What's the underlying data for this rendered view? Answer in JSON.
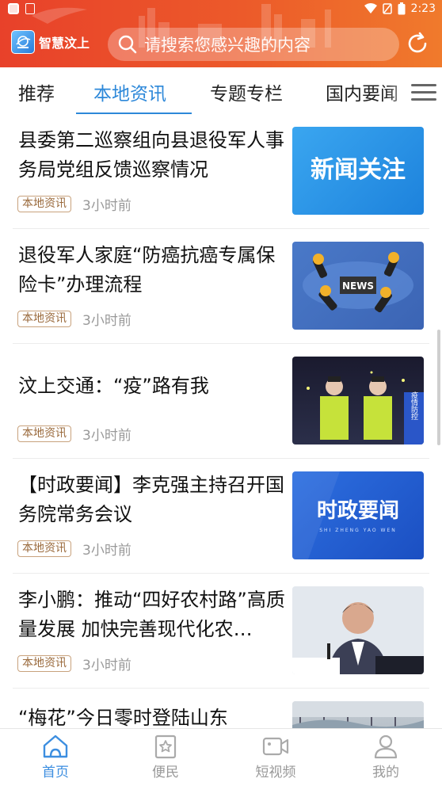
{
  "status_bar": {
    "time": "2:23"
  },
  "header": {
    "app_name": "智慧汶上",
    "search_placeholder": "请搜索您感兴趣的内容",
    "brand_color": "#e8412a"
  },
  "tabs": [
    {
      "label": "推荐",
      "active": false
    },
    {
      "label": "本地资讯",
      "active": true
    },
    {
      "label": "专题专栏",
      "active": false
    },
    {
      "label": "国内要闻",
      "active": false
    }
  ],
  "feed": [
    {
      "title": "县委第二巡察组向县退役军人事务局党组反馈巡察情况",
      "tag": "本地资讯",
      "time": "3小时前",
      "thumb_text": "新闻关注"
    },
    {
      "title": "退役军人家庭“防癌抗癌专属保险卡”办理流程",
      "tag": "本地资讯",
      "time": "3小时前",
      "thumb_text": "NEWS"
    },
    {
      "title": "汶上交通：“疫”路有我",
      "tag": "本地资讯",
      "time": "3小时前",
      "thumb_text": "疫情防控"
    },
    {
      "title": "【时政要闻】李克强主持召开国务院常务会议",
      "tag": "本地资讯",
      "time": "3小时前",
      "thumb_text": "时政要闻",
      "thumb_subtext": "SHI ZHENG YAO WEN"
    },
    {
      "title": "李小鹏：推动“四好农村路”高质量发展 加快完善现代化农…",
      "tag": "本地资讯",
      "time": "3小时前"
    },
    {
      "title": "“梅花”今日零时登陆山东"
    }
  ],
  "bottom_nav": [
    {
      "label": "首页",
      "icon": "home-icon",
      "active": true
    },
    {
      "label": "便民",
      "icon": "star-bookmark-icon",
      "active": false
    },
    {
      "label": "短视频",
      "icon": "video-icon",
      "active": false
    },
    {
      "label": "我的",
      "icon": "user-icon",
      "active": false
    }
  ]
}
